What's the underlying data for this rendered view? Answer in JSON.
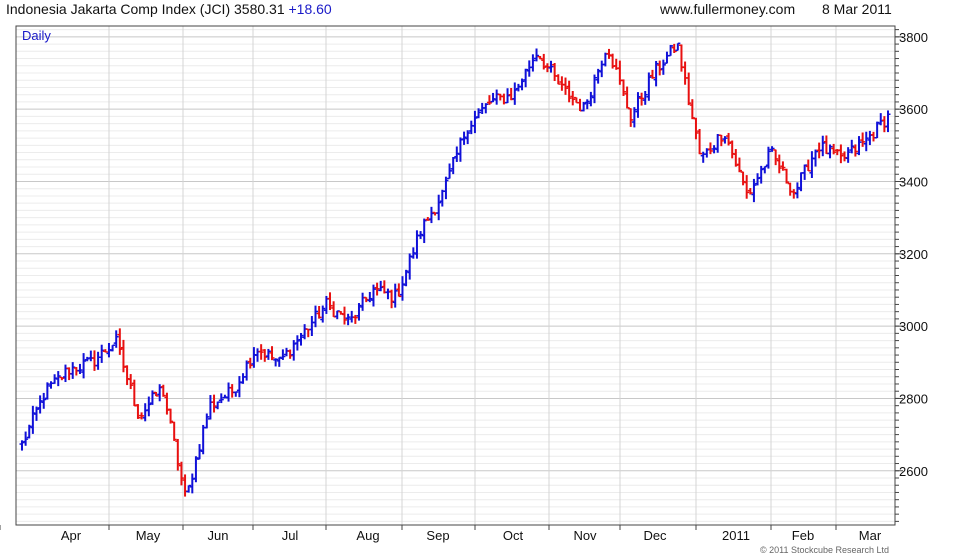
{
  "header": {
    "title": "Indonesia Jakarta Comp Index (JCI)",
    "last": "3580.31",
    "change": "+18.60",
    "site": "www.fullermoney.com",
    "date": "8 Mar 2011"
  },
  "copyright": "© 2011 Stockcube Research Ltd",
  "colors": {
    "up": "#1010d8",
    "down": "#e81010",
    "grid": "#d4d4d4",
    "frame": "#444444",
    "label": "#1a1ac8"
  },
  "chart_data": {
    "type": "ohlc",
    "period_label": "Daily",
    "x_tick_labels": [
      "Apr",
      "May",
      "Jun",
      "Jul",
      "Aug",
      "Sep",
      "Oct",
      "Nov",
      "Dec",
      "2011",
      "Feb",
      "Mar"
    ],
    "y_tick_labels": [
      "2600",
      "2800",
      "3000",
      "3200",
      "3400",
      "3600",
      "3800"
    ],
    "ylim": [
      2450,
      3830
    ],
    "grid": true,
    "anchors": [
      [
        "Mar",
        2672
      ],
      [
        "Apr",
        2820
      ],
      [
        "",
        2880
      ],
      [
        "",
        2900
      ],
      [
        "May",
        2960
      ],
      [
        "",
        2750
      ],
      [
        "",
        2830
      ],
      [
        "Jun",
        2520
      ],
      [
        "",
        2780
      ],
      [
        "",
        2820
      ],
      [
        "Jul",
        2940
      ],
      [
        "",
        2900
      ],
      [
        "",
        2980
      ],
      [
        "Aug",
        3060
      ],
      [
        "",
        3010
      ],
      [
        "",
        3100
      ],
      [
        "Sep",
        3080
      ],
      [
        "",
        3260
      ],
      [
        "",
        3370
      ],
      [
        "Oct",
        3550
      ],
      [
        "",
        3620
      ],
      [
        "",
        3640
      ],
      [
        "Nov",
        3760
      ],
      [
        "",
        3660
      ],
      [
        "",
        3600
      ],
      [
        "Dec",
        3780
      ],
      [
        "",
        3580
      ],
      [
        "",
        3700
      ],
      [
        "2011",
        3780
      ],
      [
        "",
        3460
      ],
      [
        "",
        3540
      ],
      [
        "",
        3360
      ],
      [
        "Feb",
        3480
      ],
      [
        "",
        3370
      ],
      [
        "",
        3500
      ],
      [
        "",
        3460
      ],
      [
        "Mar",
        3510
      ],
      [
        "",
        3580
      ]
    ]
  }
}
